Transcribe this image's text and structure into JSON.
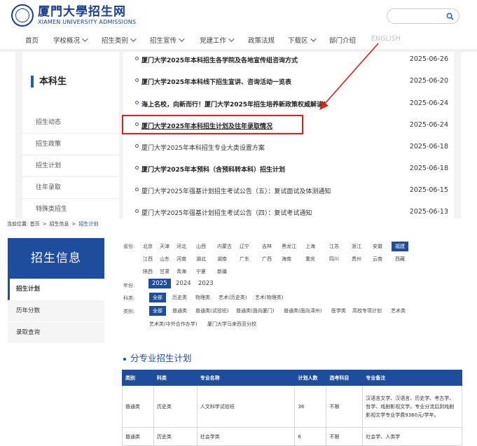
{
  "top": {
    "logo": {
      "name_cn": "厦門大學招生网",
      "name_en": "XIAMEN UNIVERSITY ADMISSIONS"
    },
    "search": {
      "placeholder": ""
    },
    "nav": [
      {
        "label": "首页",
        "dropdown": false
      },
      {
        "label": "学校概况",
        "dropdown": true
      },
      {
        "label": "招生类别",
        "dropdown": true
      },
      {
        "label": "招生宣传",
        "dropdown": true
      },
      {
        "label": "党建工作",
        "dropdown": true
      },
      {
        "label": "政策法规",
        "dropdown": false
      },
      {
        "label": "下载区",
        "dropdown": true
      },
      {
        "label": "部门介绍",
        "dropdown": false
      },
      {
        "label": "ENGLISH",
        "dropdown": false
      }
    ],
    "section_title": "本科生",
    "side_menu": [
      "招生动态",
      "招生政策",
      "招生计划",
      "往年录取",
      "特殊类招生"
    ],
    "news": [
      {
        "title": "厦门大学2025年本科招生各学院及各地宣传组咨询方式",
        "date": "2025-06-26",
        "bold": true
      },
      {
        "title": "厦门大学2025年本科线下招生宣讲、咨询活动一览表",
        "date": "2025-06-20",
        "bold": true
      },
      {
        "title": "海上名校，向新而行！厦门大学2025年招生培养新政策权威解读！",
        "date": "2025-06-24",
        "bold": true
      },
      {
        "title": "厦门大学2025年本科招生计划及往年录取情况",
        "date": "2025-06-24",
        "bold": true
      },
      {
        "title": "厦门大学2025年本科招生专业大类设置方案",
        "date": "2025-06-18",
        "bold": false
      },
      {
        "title": "厦门大学2025年本预科（含预科转本科）招生计划",
        "date": "2025-06-18",
        "bold": true
      },
      {
        "title": "厦门大学2025年强基计划招生考试公告（五）：复试面试及体测通知",
        "date": "2025-06-15",
        "bold": false
      },
      {
        "title": "厦门大学2025年强基计划招生考试公告（四）：复试考试通知",
        "date": "2025-06-13",
        "bold": false
      }
    ],
    "colors": {
      "highlight_box": "#e21b1b",
      "accent": "#2a5db0"
    }
  },
  "bottom": {
    "breadcrumb": {
      "prefix": "当前位置:",
      "items": [
        "首页",
        "招生信息",
        "招生计划"
      ],
      "sep": ">"
    },
    "panel_title": "招生信息",
    "left_menu": [
      {
        "label": "招生计划",
        "active": true
      },
      {
        "label": "历年分数",
        "active": false
      },
      {
        "label": "录取查询",
        "active": false
      }
    ],
    "filters": {
      "province_label": "省份:",
      "provinces": [
        "北京",
        "天津",
        "河北",
        "山西",
        "内蒙古",
        "辽宁",
        "吉林",
        "黑龙江",
        "上海",
        "江苏",
        "浙江",
        "安徽",
        "福建",
        "江西",
        "山东",
        "河南",
        "湖北",
        "湖南",
        "广东",
        "广西",
        "海南",
        "重庆",
        "四川",
        "贵州",
        "云南",
        "西藏",
        "陕西",
        "甘肃",
        "青海",
        "宁夏",
        "新疆"
      ],
      "province_selected": "福建",
      "year_label": "年份:",
      "years": [
        "2025",
        "2024",
        "2023"
      ],
      "year_selected": "2025",
      "subject_label": "科类:",
      "subjects": [
        "全部",
        "历史类",
        "物理类",
        "艺术(历史类)",
        "艺术(物理类)"
      ],
      "subject_selected": "全部",
      "category_label": "类别:",
      "categories": [
        "全部",
        "普通类",
        "普通类(试验班)",
        "普通类(面向厦门)",
        "普通类(面向漳州)",
        "医学类",
        "高校专项计划",
        "艺术类",
        "艺术类(中外合作办学)",
        "厦门大学马来西亚分校"
      ],
      "category_selected": "全部"
    },
    "section_title": "分专业招生计划",
    "table": {
      "headers": [
        "类别",
        "科类",
        "专业名称",
        "计划人数",
        "选考科目",
        "专业备注"
      ],
      "rows": [
        [
          "普通类",
          "历史类",
          "人文科学试验班",
          "36",
          "不限",
          "汉语言文学、汉语言、历史学、考古学、哲学、戏剧影视文学。专业分流后到戏剧影视文学专业学费9360元/学年。"
        ],
        [
          "普通类",
          "历史类",
          "社会学类",
          "6",
          "不限",
          "社会学、人类学"
        ]
      ]
    }
  }
}
